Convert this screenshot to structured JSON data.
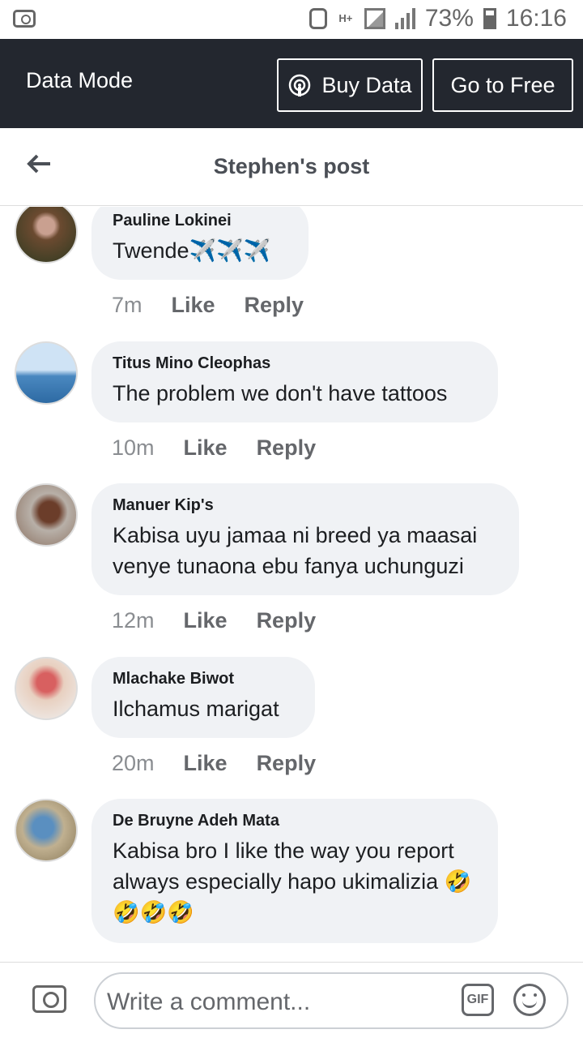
{
  "status_bar": {
    "battery": "73%",
    "time": "16:16",
    "network": "H+"
  },
  "data_mode": {
    "label": "Data Mode",
    "buy_label": "Buy Data",
    "free_label": "Go to Free"
  },
  "header": {
    "title": "Stephen's post"
  },
  "comments": [
    {
      "author": "Pauline Lokinei",
      "text": "Twende✈️✈️✈️",
      "time": "7m",
      "like": "Like",
      "reply": "Reply"
    },
    {
      "author": "Titus Mino Cleophas",
      "text": "The problem we don't have tattoos",
      "time": "10m",
      "like": "Like",
      "reply": "Reply"
    },
    {
      "author": "Manuer Kip's",
      "text": "Kabisa uyu jamaa ni breed ya maasai venye tunaona ebu fanya uchunguzi",
      "time": "12m",
      "like": "Like",
      "reply": "Reply"
    },
    {
      "author": "Mlachake Biwot",
      "text": "Ilchamus marigat",
      "time": "20m",
      "like": "Like",
      "reply": "Reply"
    },
    {
      "author": "De Bruyne Adeh Mata",
      "text": "Kabisa bro I like the way you report always especially hapo ukimalizia 🤣🤣🤣🤣",
      "time": "",
      "like": "",
      "reply": ""
    }
  ],
  "composer": {
    "placeholder": "Write a comment...",
    "gif_label": "GIF"
  }
}
